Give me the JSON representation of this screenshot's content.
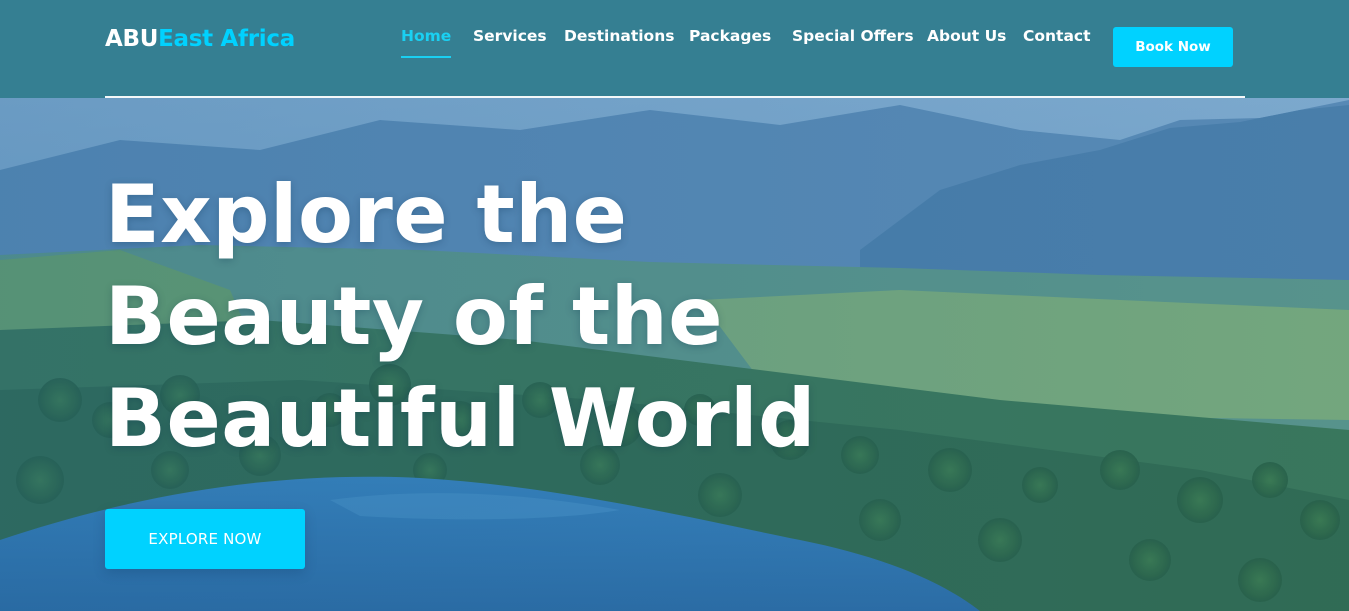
{
  "brand": {
    "name_part1": "ABU",
    "name_part2": "East Africa",
    "accent_color": "#00d2ff",
    "header_color": "#357f92"
  },
  "nav": {
    "items": [
      {
        "label": "Home",
        "active": true
      },
      {
        "label": "Services",
        "active": false
      },
      {
        "label": "Destinations",
        "active": false
      },
      {
        "label": "Packages",
        "active": false
      },
      {
        "label": "Special Offers",
        "active": false
      },
      {
        "label": "About Us",
        "active": false
      },
      {
        "label": "Contact",
        "active": false
      }
    ],
    "cta_label": "Book Now"
  },
  "hero": {
    "title": "Explore the Beauty of the Beautiful World",
    "button_label": "EXPLORE NOW",
    "background": "aerial-landscape-lake-forest"
  }
}
